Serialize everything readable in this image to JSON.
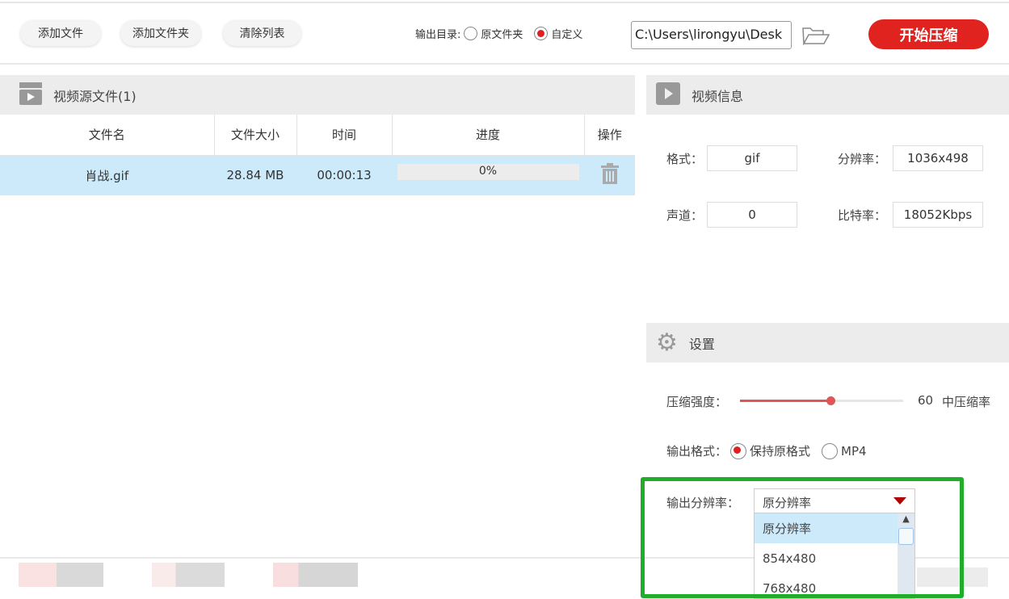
{
  "toolbar": {
    "add_file": "添加文件",
    "add_folder": "添加文件夹",
    "clear_list": "清除列表",
    "output_dir_label": "输出目录:",
    "opt_original": "原文件夹",
    "opt_custom": "自定义",
    "output_path": "C:\\Users\\lirongyu\\Desk",
    "start": "开始压缩"
  },
  "source": {
    "title": "视频源文件(1)",
    "columns": [
      "文件名",
      "文件大小",
      "时间",
      "进度",
      "操作"
    ],
    "rows": [
      {
        "name": "肖战.gif",
        "size": "28.84 MB",
        "time": "00:00:13",
        "progress": "0%"
      }
    ]
  },
  "info": {
    "title": "视频信息",
    "format_label": "格式：",
    "format": "gif",
    "resolution_label": "分辨率：",
    "resolution": "1036x498",
    "channel_label": "声道：",
    "channel": "0",
    "bitrate_label": "比特率：",
    "bitrate": "18052Kbps"
  },
  "settings": {
    "title": "设置",
    "strength_label": "压缩强度：",
    "strength_value": "60",
    "strength_percent": 60,
    "strength_desc": "中压缩率",
    "format_label": "输出格式：",
    "format_keep": "保持原格式",
    "format_mp4": "MP4",
    "res_label": "输出分辨率：",
    "res_selected": "原分辨率",
    "res_options": [
      "原分辨率",
      "854x480",
      "768x480"
    ]
  },
  "colors": {
    "accent": "#e0231e",
    "highlight": "#cdeafb",
    "annotation": "#1fad2a"
  }
}
